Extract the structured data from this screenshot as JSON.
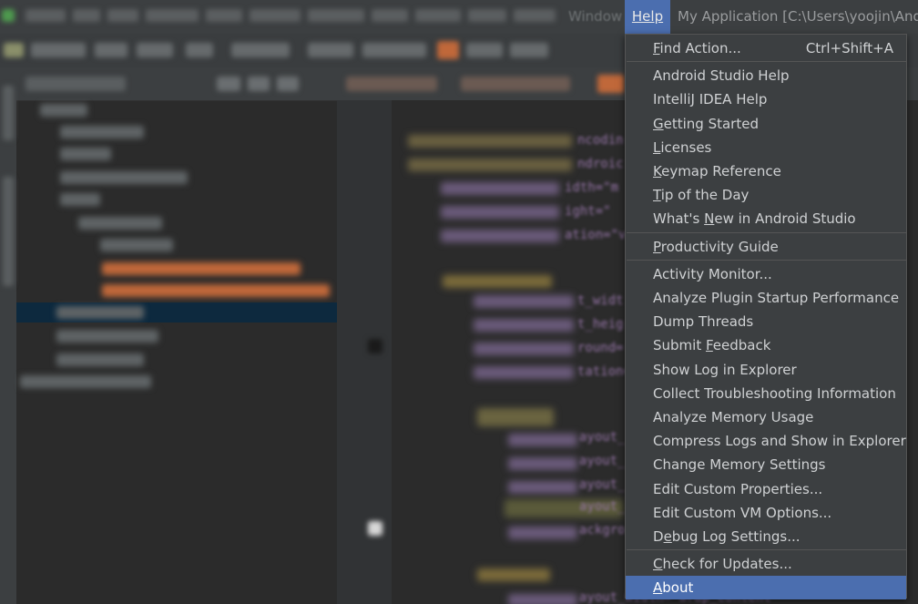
{
  "menubar": {
    "window_label": "Window",
    "help_label": "Help",
    "title": "My Application [C:\\Users\\yoojin\\And"
  },
  "help_menu": {
    "groups": [
      [
        {
          "label": "Find Action...",
          "u": "F",
          "shortcut": "Ctrl+Shift+A"
        }
      ],
      [
        {
          "label": "Android Studio Help"
        },
        {
          "label": "IntelliJ IDEA Help"
        },
        {
          "label": "Getting Started",
          "u": "G"
        },
        {
          "label": "Licenses",
          "u": "L"
        },
        {
          "label": "Keymap Reference",
          "u": "K"
        },
        {
          "label": "Tip of the Day",
          "u": "T"
        },
        {
          "label": "What's New in Android Studio",
          "u": "N",
          "u_index": 7
        }
      ],
      [
        {
          "label": "Productivity Guide",
          "u": "P"
        }
      ],
      [
        {
          "label": "Activity Monitor..."
        },
        {
          "label": "Analyze Plugin Startup Performance"
        },
        {
          "label": "Dump Threads"
        },
        {
          "label": "Submit Feedback",
          "u": "F",
          "u_index": 7
        },
        {
          "label": "Show Log in Explorer"
        },
        {
          "label": "Collect Troubleshooting Information"
        },
        {
          "label": "Analyze Memory Usage"
        },
        {
          "label": "Compress Logs and Show in Explorer"
        },
        {
          "label": "Change Memory Settings"
        },
        {
          "label": "Edit Custom Properties..."
        },
        {
          "label": "Edit Custom VM Options..."
        },
        {
          "label": "Debug Log Settings...",
          "u": "e",
          "u_index": 1
        }
      ],
      [
        {
          "label": "Check for Updates...",
          "u": "C"
        },
        {
          "label": "About",
          "u": "A",
          "selected": true
        }
      ]
    ]
  },
  "editor": {
    "visible_fragments": [
      {
        "text": "ncodin"
      },
      {
        "text": "ndroic"
      },
      {
        "text": "idth=\"m"
      },
      {
        "text": "ight=\""
      },
      {
        "text": "ation=\"ve"
      },
      {
        "text": "t_widt"
      },
      {
        "text": "t_heig"
      },
      {
        "text": "round="
      },
      {
        "text": "tation="
      },
      {
        "text": "ayout_"
      },
      {
        "text": "ayout_"
      },
      {
        "text": "ayout_"
      },
      {
        "text": "ayout_"
      },
      {
        "text": "ackgro"
      },
      {
        "text": "ayout_width=\"wrap_content\""
      }
    ]
  },
  "colors": {
    "menu_bg": "#3c3f41",
    "selection": "#4b6eaf",
    "editor_bg": "#2b2b2b",
    "tree_selection": "#0d293e"
  }
}
